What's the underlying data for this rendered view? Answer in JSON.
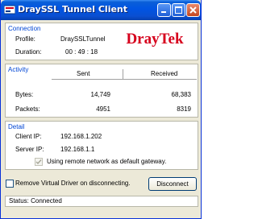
{
  "window": {
    "title": "DraySSL Tunnel Client",
    "controls": [
      "minimize-icon",
      "maximize-icon",
      "close-icon"
    ]
  },
  "connection": {
    "title": "Connection",
    "profile_label": "Profile:",
    "profile_value": "DraySSLTunnel",
    "duration_label": "Duration:",
    "duration_value": "00 : 49 : 18",
    "logo_text": "DrayTek"
  },
  "activity": {
    "title": "Activity",
    "col_sent": "Sent",
    "col_received": "Received",
    "rows": [
      {
        "label": "Bytes:",
        "sent": "14,749",
        "received": "68,383"
      },
      {
        "label": "Packets:",
        "sent": "4951",
        "received": "8319"
      }
    ]
  },
  "detail": {
    "title": "Detail",
    "client_ip_label": "Client IP:",
    "client_ip_value": "192.168.1.202",
    "server_ip_label": "Server IP:",
    "server_ip_value": "192.168.1.1",
    "gateway_option": "Using remote network as default gateway.",
    "gateway_checked": true
  },
  "options": {
    "remove_driver_label": "Remove Virtual Driver on disconnecting.",
    "remove_driver_checked": false,
    "disconnect_label": "Disconnect"
  },
  "status": {
    "text": "Status: Connected"
  },
  "colors": {
    "titlebar": "#0054e3",
    "group_title": "#0046d5",
    "logo_red": "#d6001c"
  }
}
